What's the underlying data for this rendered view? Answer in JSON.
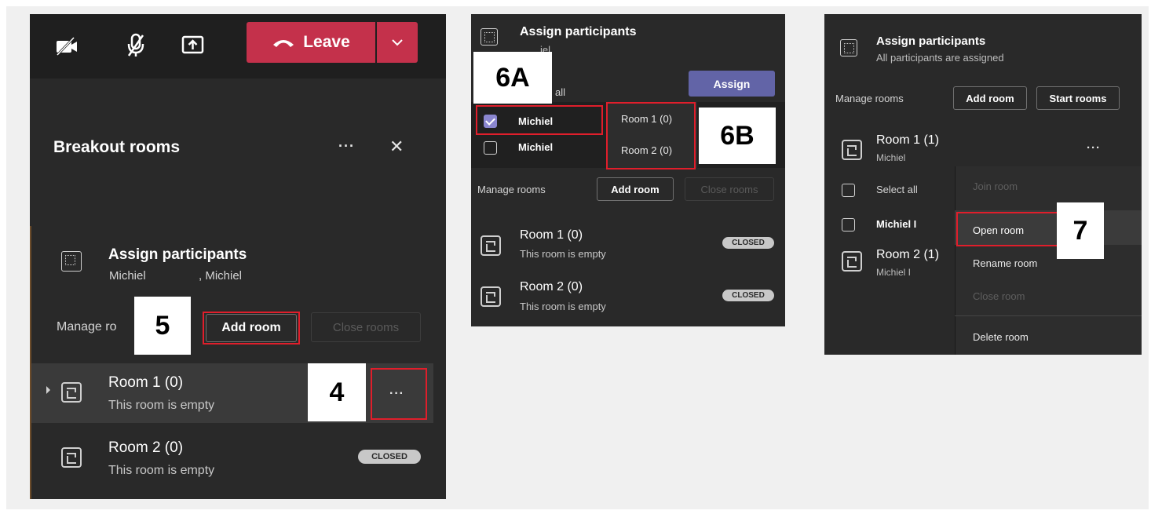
{
  "panel1": {
    "leave_label": "Leave",
    "title": "Breakout rooms",
    "assign": {
      "title": "Assign participants",
      "subtitle_a": "Michiel",
      "subtitle_b": ", Michiel"
    },
    "manage_label": "Manage ro",
    "add_room_label": "Add room",
    "close_rooms_label": "Close rooms",
    "rooms": [
      {
        "name": "Room 1 (0)",
        "status": "This room is empty"
      },
      {
        "name": "Room 2 (0)",
        "status": "This room is empty",
        "badge": "CLOSED"
      }
    ],
    "callouts": {
      "c5": "5",
      "c4": "4"
    }
  },
  "panel2": {
    "assign_title": "Assign participants",
    "assign_sub": "iel",
    "select_all_partial": "all",
    "assign_button": "Assign",
    "participants": [
      {
        "name": "Michiel",
        "checked": true
      },
      {
        "name": "Michiel",
        "checked": false
      }
    ],
    "room_options": [
      "Room 1 (0)",
      "Room 2 (0)"
    ],
    "manage_label": "Manage rooms",
    "add_room_label": "Add room",
    "close_rooms_label": "Close rooms",
    "rooms": [
      {
        "name": "Room 1 (0)",
        "status": "This room is empty",
        "badge": "CLOSED"
      },
      {
        "name": "Room 2 (0)",
        "status": "This room is empty",
        "badge": "CLOSED"
      }
    ],
    "callouts": {
      "c6a": "6A",
      "c6b": "6B"
    }
  },
  "panel3": {
    "assign_title": "Assign participants",
    "assign_sub": "All participants are assigned",
    "manage_label": "Manage rooms",
    "add_room_label": "Add room",
    "start_rooms_label": "Start rooms",
    "rooms": [
      {
        "name": "Room 1 (1)",
        "member": "Michiel"
      },
      {
        "name": "Room 2 (1)",
        "member": "Michiel I"
      }
    ],
    "select_all": "Select all",
    "participant": "Michiel I",
    "menu": [
      "Join room",
      "Open room",
      "Rename room",
      "Close room",
      "Delete room"
    ],
    "callouts": {
      "c7": "7"
    }
  },
  "colors": {
    "accent": "#c4314b",
    "purple": "#6264a7",
    "highlight": "#e01e2b"
  }
}
